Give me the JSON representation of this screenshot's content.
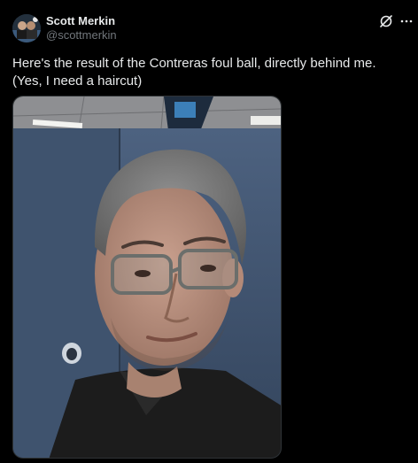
{
  "author": {
    "name": "Scott Merkin",
    "handle": "@scottmerkin"
  },
  "post": {
    "text": "Here's the result of the Contreras foul ball, directly behind me. (Yes, I need a haircut)"
  },
  "icons": {
    "grok": "grok-icon",
    "more": "more-icon"
  },
  "colors": {
    "background": "#000000",
    "primary_text": "#e7e9ea",
    "secondary_text": "#71767b",
    "border": "#2f3336"
  }
}
